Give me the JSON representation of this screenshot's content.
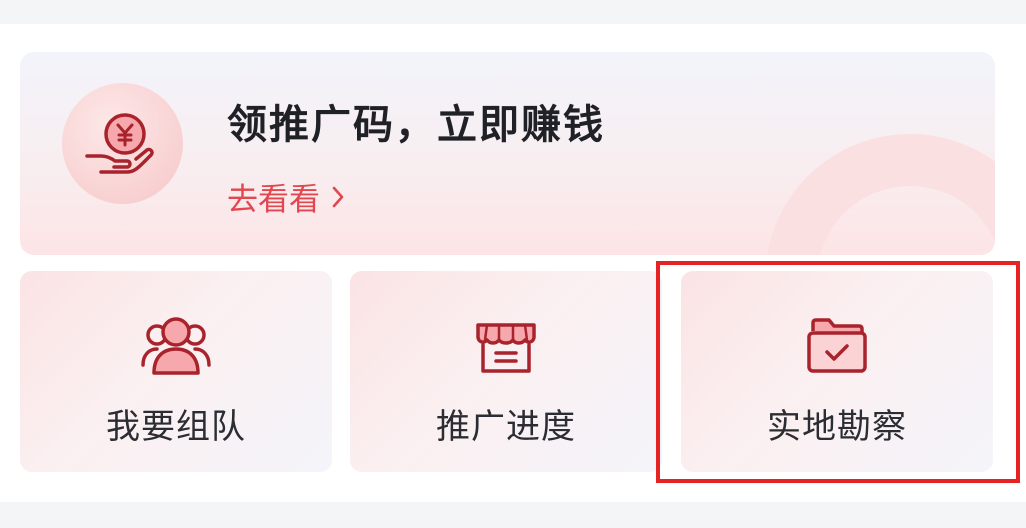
{
  "banner": {
    "title": "领推广码，立即赚钱",
    "link_label": "去看看",
    "icon": "coin-hand-icon"
  },
  "actions": [
    {
      "label": "我要组队",
      "icon": "team-icon"
    },
    {
      "label": "推广进度",
      "icon": "store-progress-icon"
    },
    {
      "label": "实地勘察",
      "icon": "folder-check-icon"
    }
  ],
  "colors": {
    "accent": "#e0474f",
    "icon_stroke": "#a8232c",
    "icon_fill": "#f6a8ad",
    "highlight": "#e52324",
    "title_text": "#1f2127",
    "label_text": "#2b2d33"
  }
}
